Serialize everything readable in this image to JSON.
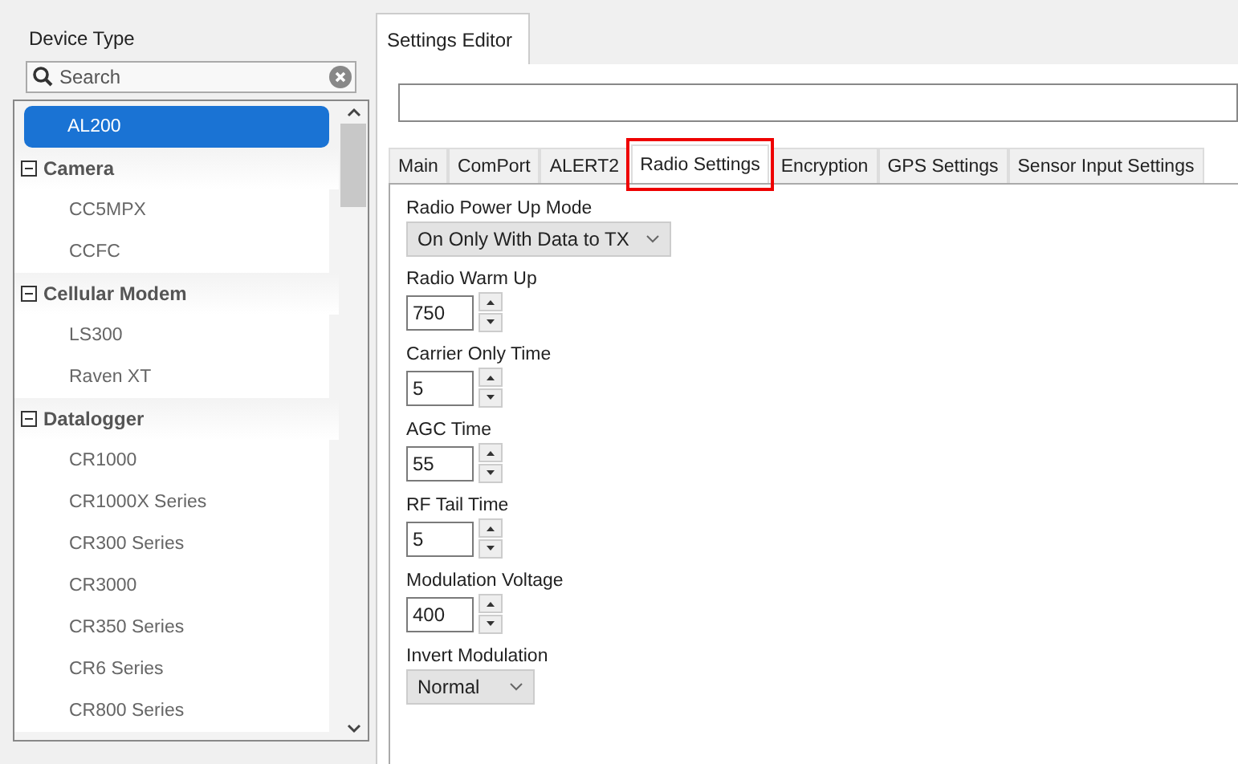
{
  "sidebar": {
    "title": "Device Type",
    "search": {
      "placeholder": "Search"
    },
    "tree": [
      {
        "label": "AL200",
        "selected": true
      },
      {
        "label": "Camera",
        "expanded": true,
        "children": [
          {
            "label": "CC5MPX",
            "selected": false
          },
          {
            "label": "CCFC",
            "selected": false
          }
        ]
      },
      {
        "label": "Cellular Modem",
        "expanded": true,
        "children": [
          {
            "label": "LS300",
            "selected": false
          },
          {
            "label": "Raven XT",
            "selected": false
          }
        ]
      },
      {
        "label": "Datalogger",
        "expanded": true,
        "children": [
          {
            "label": "CR1000",
            "selected": false
          },
          {
            "label": "CR1000X Series",
            "selected": false
          },
          {
            "label": "CR300 Series",
            "selected": false
          },
          {
            "label": "CR3000",
            "selected": false
          },
          {
            "label": "CR350 Series",
            "selected": false
          },
          {
            "label": "CR6 Series",
            "selected": false
          },
          {
            "label": "CR800 Series",
            "selected": false
          }
        ]
      }
    ]
  },
  "editor": {
    "tab": "Settings Editor",
    "tabs": [
      {
        "label": "Main",
        "selected": false,
        "highlighted": false
      },
      {
        "label": "ComPort",
        "selected": false,
        "highlighted": false
      },
      {
        "label": "ALERT2",
        "selected": false,
        "highlighted": false
      },
      {
        "label": "Radio Settings",
        "selected": true,
        "highlighted": true
      },
      {
        "label": "Encryption",
        "selected": false,
        "highlighted": false
      },
      {
        "label": "GPS Settings",
        "selected": false,
        "highlighted": false
      },
      {
        "label": "Sensor Input Settings",
        "selected": false,
        "highlighted": false
      }
    ],
    "settings": [
      {
        "kind": "dropdown",
        "label": "Radio Power Up Mode",
        "value": "On Only With Data to TX"
      },
      {
        "kind": "spinner",
        "label": "Radio Warm Up",
        "value": "750"
      },
      {
        "kind": "spinner",
        "label": "Carrier Only Time",
        "value": "5"
      },
      {
        "kind": "spinner",
        "label": "AGC Time",
        "value": "55"
      },
      {
        "kind": "spinner",
        "label": "RF Tail Time",
        "value": "5"
      },
      {
        "kind": "spinner",
        "label": "Modulation Voltage",
        "value": "400"
      },
      {
        "kind": "dropdown",
        "label": "Invert Modulation",
        "value": "Normal"
      }
    ]
  }
}
